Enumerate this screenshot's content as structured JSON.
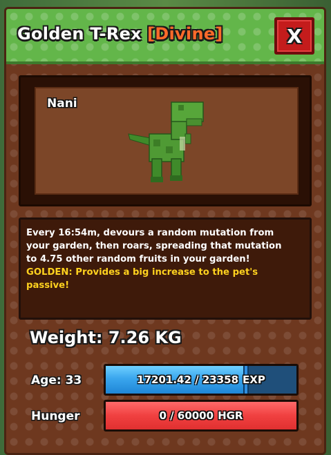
{
  "header": {
    "title": "Golden T-Rex",
    "rarity": "[Divine]",
    "close_label": "X"
  },
  "pet": {
    "name": "Nani",
    "model_icon": "trex-model"
  },
  "description": {
    "lines": [
      "Every 16:54m, devours a random mutation from",
      "your garden, then roars, spreading that mutation",
      "to 4.75 other random fruits in your garden!"
    ],
    "golden_lines": [
      "GOLDEN: Provides a big increase to the pet's",
      "passive!"
    ]
  },
  "stats": {
    "weight": "Weight: 7.26 KG",
    "age_label": "Age: 33",
    "exp_text": "17201.42 / 23358",
    "exp_unit": "EXP",
    "exp_fraction": 0.7364,
    "hunger_label": "Hunger",
    "hunger_text": "0 / 60000",
    "hunger_unit": "HGR",
    "hunger_fraction": 0.0
  },
  "colors": {
    "header_green": "#63b64a",
    "rarity_orange": "#ff6a2a",
    "close_red": "#c41c1c",
    "golden_text": "#ffd21f",
    "exp_blue": "#3aa6ee",
    "hunger_red": "#f04040"
  }
}
